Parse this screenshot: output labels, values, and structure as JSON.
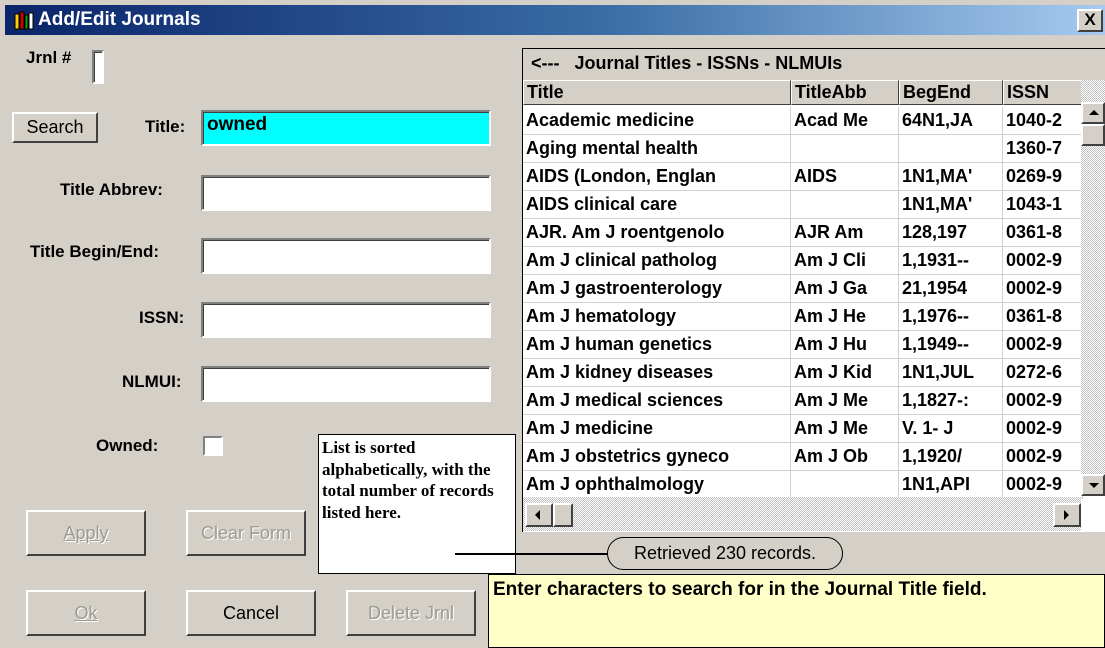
{
  "window": {
    "title": "Add/Edit Journals",
    "close_label": "X"
  },
  "form": {
    "jrnl_label": "Jrnl #",
    "search_label": "Search",
    "title_label": "Title:",
    "title_value": "owned",
    "title_abbrev_label": "Title Abbrev:",
    "title_begin_end_label": "Title Begin/End:",
    "issn_label": "ISSN:",
    "nlmui_label": "NLMUI:",
    "owned_label": "Owned:",
    "apply_label": "Apply",
    "clear_form_label": "Clear Form",
    "ok_label": "Ok",
    "cancel_label": "Cancel",
    "delete_label": "Delete Jrnl"
  },
  "grid": {
    "caption": "<---   Journal Titles - ISSNs - NLMUIs",
    "columns": [
      "Title",
      "TitleAbb",
      "BegEnd",
      "ISSN"
    ],
    "rows": [
      [
        "Academic medicine",
        "Acad Me",
        "64N1,JA",
        "1040-2"
      ],
      [
        "Aging mental health",
        "",
        "",
        "1360-7"
      ],
      [
        "AIDS (London, Englan",
        "AIDS",
        "1N1,MA'",
        "0269-9"
      ],
      [
        "AIDS clinical care",
        "",
        "1N1,MA'",
        "1043-1"
      ],
      [
        "AJR. Am J roentgenolo",
        "AJR Am",
        "128,197",
        "0361-8"
      ],
      [
        "Am J clinical patholog",
        "Am J Cli",
        "1,1931--",
        "0002-9"
      ],
      [
        "Am J gastroenterology",
        "Am J Ga",
        "21,1954",
        "0002-9"
      ],
      [
        "Am J hematology",
        "Am J He",
        "1,1976--",
        "0361-8"
      ],
      [
        "Am J human genetics",
        "Am J Hu",
        "1,1949--",
        "0002-9"
      ],
      [
        "Am J kidney diseases",
        "Am J Kid",
        "1N1,JUL",
        "0272-6"
      ],
      [
        "Am J medical sciences",
        "Am J Me",
        "1,1827-:",
        "0002-9"
      ],
      [
        "Am J medicine",
        "Am J Me",
        "V. 1-   J",
        "0002-9"
      ],
      [
        "Am J obstetrics gyneco",
        "Am J Ob",
        "1,1920/",
        "0002-9"
      ],
      [
        "Am J ophthalmology",
        "",
        "1N1,API",
        "0002-9"
      ]
    ]
  },
  "callout": "List is sorted alphabetically, with the total number of records listed here.",
  "status": "Retrieved 230 records.",
  "hint": "Enter characters to search for in the Journal Title field.",
  "colors": {
    "title_field_bg": "#00ffff",
    "hint_bg": "#ffffc8",
    "titlebar": "#0a246a"
  }
}
